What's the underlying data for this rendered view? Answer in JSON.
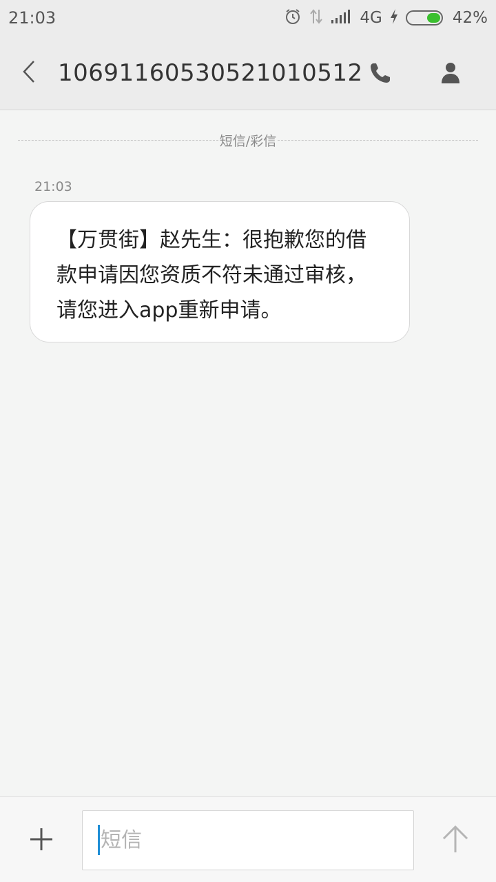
{
  "status_bar": {
    "time": "21:03",
    "network": "4G",
    "battery_percent": "42%",
    "battery_level": 0.42,
    "icons": [
      "alarm-icon",
      "data-arrows-icon",
      "signal-icon",
      "charging-icon",
      "battery-icon"
    ]
  },
  "header": {
    "title": "1069116053052101051​2",
    "back_icon": "chevron-left-icon",
    "call_icon": "phone-icon",
    "contact_icon": "person-icon"
  },
  "conversation": {
    "channel_label": "短信/彩信",
    "messages": [
      {
        "time": "21:03",
        "text": "【万贯街】赵先生：很抱歉您的借款申请因您资质不符未通过审核，请您进入app重新申请。"
      }
    ]
  },
  "composer": {
    "add_icon": "plus-icon",
    "placeholder": "短信",
    "value": "",
    "send_icon": "arrow-up-icon"
  },
  "colors": {
    "background": "#f4f5f4",
    "header_bg": "#ececec",
    "bubble_bg": "#ffffff",
    "battery_fill": "#3bbf2f",
    "caret": "#1f8ed6"
  }
}
